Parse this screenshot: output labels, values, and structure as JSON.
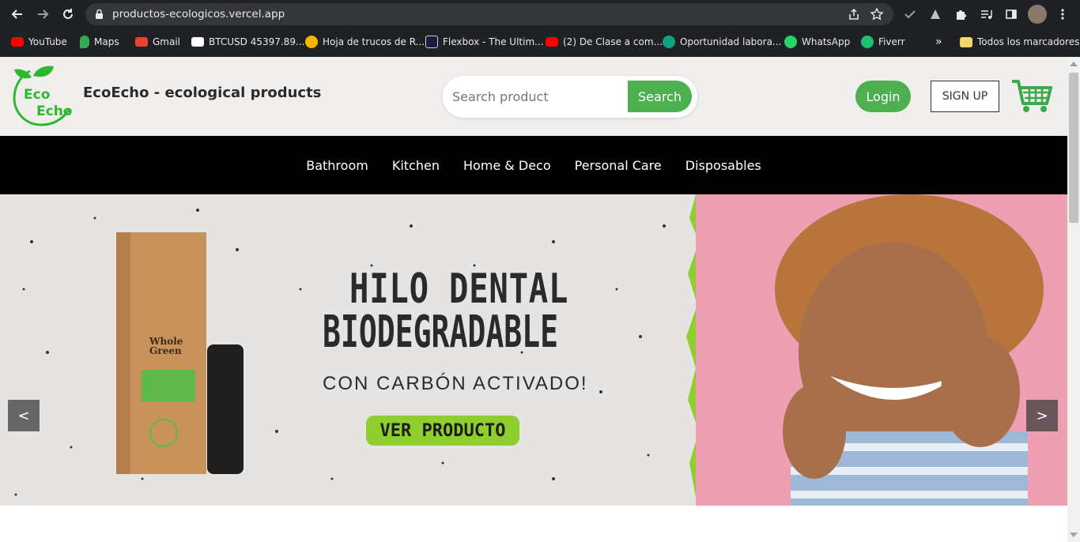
{
  "browser": {
    "url": "productos-ecologicos.vercel.app",
    "bookmarks": [
      {
        "label": "YouTube",
        "icon": "youtube-icon"
      },
      {
        "label": "Maps",
        "icon": "maps-icon"
      },
      {
        "label": "Gmail",
        "icon": "gmail-icon"
      },
      {
        "label": "BTCUSD 45397.89...",
        "icon": "tradingview-icon"
      },
      {
        "label": "Hoja de trucos de R...",
        "icon": "bookmark-icon"
      },
      {
        "label": "Flexbox - The Ultim...",
        "icon": "bookmark-icon"
      },
      {
        "label": "(2) De Clase a com...",
        "icon": "youtube-icon"
      },
      {
        "label": "Oportunidad labora...",
        "icon": "openai-icon"
      },
      {
        "label": "WhatsApp",
        "icon": "whatsapp-icon"
      },
      {
        "label": "Fiverr",
        "icon": "fiverr-icon"
      }
    ],
    "overflow": "»",
    "all_bookmarks": "Todos los marcadores"
  },
  "site": {
    "brand": "EcoEcho - ecological products",
    "logo_text": {
      "line1": "Eco",
      "line2": "Echo"
    },
    "search_placeholder": "Search product",
    "search_button": "Search",
    "login_button": "Login",
    "signup_button": "SIGN UP",
    "nav": [
      "Bathroom",
      "Kitchen",
      "Home & Deco",
      "Personal Care",
      "Disposables"
    ],
    "hero": {
      "title_line1": "HILO DENTAL",
      "title_line2": "BIODEGRADABLE",
      "subtitle": "CON CARBÓN ACTIVADO!",
      "cta": "VER PRODUCTO",
      "prev": "<",
      "next": ">",
      "box_brand": "Whole Green"
    }
  },
  "colors": {
    "accent": "#4caf50",
    "cta": "#8fce2f",
    "nav_bg": "#000000",
    "header_bg": "#f1eeee",
    "hero_pink": "#ee9fb2"
  }
}
